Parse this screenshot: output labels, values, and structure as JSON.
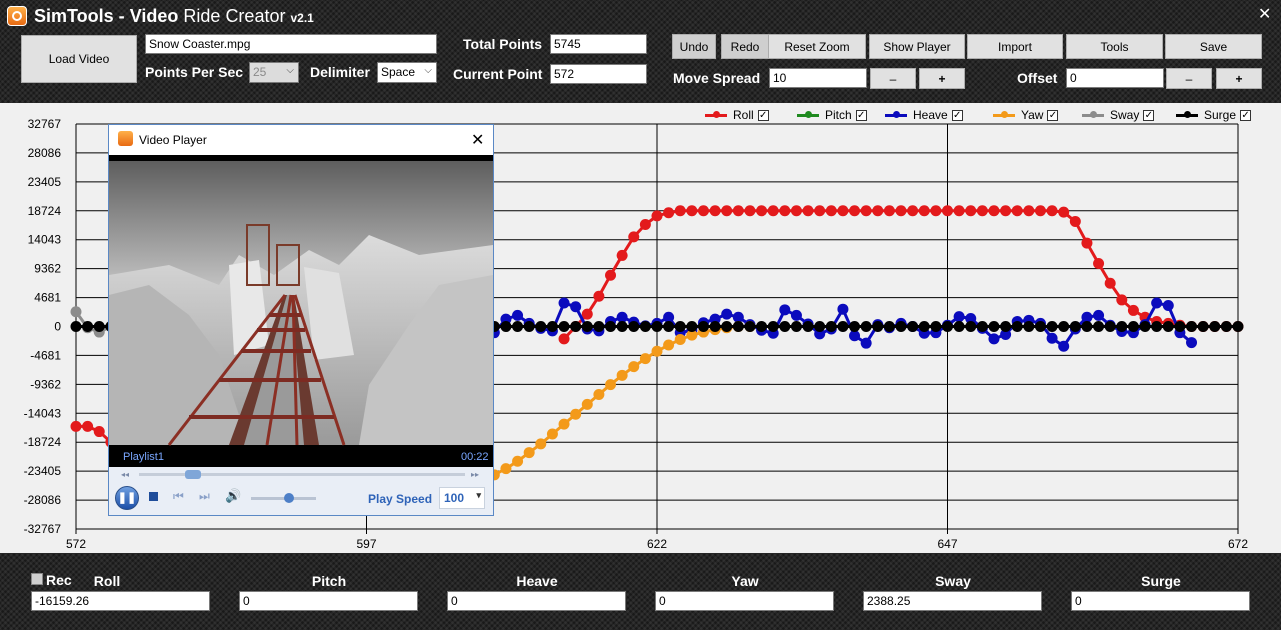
{
  "app": {
    "title_bold": "SimTools -",
    "title_mid_bold": "Video",
    "title_ride": "Ride",
    "title_creator": "Creator",
    "version": "v2.1"
  },
  "toolbar": {
    "load_video": "Load Video",
    "video_file": "Snow Coaster.mpg",
    "points_per_sec_label": "Points Per Sec",
    "points_per_sec_value": "25",
    "delimiter_label": "Delimiter",
    "delimiter_value": "Space",
    "total_points_label": "Total Points",
    "total_points_value": "5745",
    "current_point_label": "Current Point",
    "current_point_value": "572",
    "undo": "Undo",
    "redo": "Redo",
    "reset_zoom": "Reset Zoom",
    "show_player": "Show Player",
    "import": "Import",
    "tools": "Tools",
    "save": "Save",
    "move_spread_label": "Move Spread",
    "move_spread_value": "10",
    "minus": "–",
    "plus": "+",
    "offset_label": "Offset",
    "offset_value": "0"
  },
  "legend": [
    {
      "name": "Roll",
      "color": "#e31a1c",
      "checked": "✓"
    },
    {
      "name": "Pitch",
      "color": "#1f8a1f",
      "checked": "✓"
    },
    {
      "name": "Heave",
      "color": "#0b0bbd",
      "checked": "✓"
    },
    {
      "name": "Yaw",
      "color": "#f39a1a",
      "checked": "✓"
    },
    {
      "name": "Sway",
      "color": "#8c8c8c",
      "checked": "✓"
    },
    {
      "name": "Surge",
      "color": "#000000",
      "checked": "✓"
    }
  ],
  "chart_data": {
    "type": "line",
    "ylim": [
      -32767,
      32767
    ],
    "y_ticks": [
      "32767",
      "28086",
      "23405",
      "18724",
      "14043",
      "9362",
      "4681",
      "0",
      "-4681",
      "-9362",
      "-14043",
      "-18724",
      "-23405",
      "-28086",
      "-32767"
    ],
    "x_ticks": [
      "572",
      "597",
      "622",
      "647",
      "672"
    ],
    "xlim": [
      572,
      672
    ],
    "series": [
      {
        "name": "Roll",
        "color": "#e31a1c",
        "points": [
          [
            572,
            -16159
          ],
          [
            573,
            -16159
          ],
          [
            574,
            -17000
          ],
          [
            575,
            -18700
          ],
          [
            576,
            -20000
          ],
          [
            577,
            -21000
          ],
          [
            614,
            -2000
          ],
          [
            615,
            0
          ],
          [
            616,
            2000
          ],
          [
            617,
            4900
          ],
          [
            618,
            8300
          ],
          [
            619,
            11500
          ],
          [
            620,
            14500
          ],
          [
            621,
            16500
          ],
          [
            622,
            17900
          ],
          [
            623,
            18400
          ],
          [
            624,
            18724
          ],
          [
            625,
            18724
          ],
          [
            626,
            18724
          ],
          [
            627,
            18724
          ],
          [
            628,
            18724
          ],
          [
            629,
            18724
          ],
          [
            630,
            18724
          ],
          [
            631,
            18724
          ],
          [
            632,
            18724
          ],
          [
            633,
            18724
          ],
          [
            634,
            18724
          ],
          [
            635,
            18724
          ],
          [
            636,
            18724
          ],
          [
            637,
            18724
          ],
          [
            638,
            18724
          ],
          [
            639,
            18724
          ],
          [
            640,
            18724
          ],
          [
            641,
            18724
          ],
          [
            642,
            18724
          ],
          [
            643,
            18724
          ],
          [
            644,
            18724
          ],
          [
            645,
            18724
          ],
          [
            646,
            18724
          ],
          [
            647,
            18724
          ],
          [
            648,
            18724
          ],
          [
            649,
            18724
          ],
          [
            650,
            18724
          ],
          [
            651,
            18724
          ],
          [
            652,
            18724
          ],
          [
            653,
            18724
          ],
          [
            654,
            18724
          ],
          [
            655,
            18724
          ],
          [
            656,
            18724
          ],
          [
            657,
            18500
          ],
          [
            658,
            17000
          ],
          [
            659,
            13500
          ],
          [
            660,
            10200
          ],
          [
            661,
            7000
          ],
          [
            662,
            4300
          ],
          [
            663,
            2600
          ],
          [
            664,
            1500
          ],
          [
            665,
            800
          ],
          [
            666,
            500
          ],
          [
            667,
            200
          ],
          [
            668,
            0
          ],
          [
            669,
            0
          ],
          [
            670,
            0
          ],
          [
            671,
            0
          ],
          [
            672,
            0
          ]
        ]
      },
      {
        "name": "Heave",
        "color": "#0b0bbd",
        "points": [
          [
            605,
            0
          ],
          [
            606,
            -1500
          ],
          [
            607,
            -3000
          ],
          [
            608,
            -1000
          ],
          [
            609,
            1200
          ],
          [
            610,
            1800
          ],
          [
            611,
            500
          ],
          [
            612,
            -300
          ],
          [
            613,
            -700
          ],
          [
            614,
            3800
          ],
          [
            615,
            3200
          ],
          [
            616,
            -400
          ],
          [
            617,
            -700
          ],
          [
            618,
            800
          ],
          [
            619,
            1500
          ],
          [
            620,
            700
          ],
          [
            621,
            100
          ],
          [
            622,
            500
          ],
          [
            623,
            1500
          ],
          [
            624,
            -1000
          ],
          [
            625,
            -600
          ],
          [
            626,
            600
          ],
          [
            627,
            1200
          ],
          [
            628,
            2000
          ],
          [
            629,
            1500
          ],
          [
            630,
            300
          ],
          [
            631,
            -600
          ],
          [
            632,
            -1100
          ],
          [
            633,
            2700
          ],
          [
            634,
            1800
          ],
          [
            635,
            400
          ],
          [
            636,
            -1200
          ],
          [
            637,
            -400
          ],
          [
            638,
            2800
          ],
          [
            639,
            -1500
          ],
          [
            640,
            -2700
          ],
          [
            641,
            300
          ],
          [
            642,
            -200
          ],
          [
            643,
            500
          ],
          [
            644,
            0
          ],
          [
            645,
            -1100
          ],
          [
            646,
            -1000
          ],
          [
            647,
            200
          ],
          [
            648,
            1600
          ],
          [
            649,
            1300
          ],
          [
            650,
            -300
          ],
          [
            651,
            -2000
          ],
          [
            652,
            -1300
          ],
          [
            653,
            800
          ],
          [
            654,
            1000
          ],
          [
            655,
            500
          ],
          [
            656,
            -1900
          ],
          [
            657,
            -3200
          ],
          [
            658,
            -400
          ],
          [
            659,
            1500
          ],
          [
            660,
            1800
          ],
          [
            661,
            200
          ],
          [
            662,
            -800
          ],
          [
            663,
            -1000
          ],
          [
            664,
            300
          ],
          [
            665,
            3800
          ],
          [
            666,
            3400
          ],
          [
            667,
            -1000
          ],
          [
            668,
            -2600
          ]
        ]
      },
      {
        "name": "Yaw",
        "color": "#f39a1a",
        "points": [
          [
            605,
            -26500
          ],
          [
            606,
            -25800
          ],
          [
            607,
            -25000
          ],
          [
            608,
            -24000
          ],
          [
            609,
            -23000
          ],
          [
            610,
            -21800
          ],
          [
            611,
            -20400
          ],
          [
            612,
            -19000
          ],
          [
            613,
            -17400
          ],
          [
            614,
            -15800
          ],
          [
            615,
            -14200
          ],
          [
            616,
            -12600
          ],
          [
            617,
            -11000
          ],
          [
            618,
            -9400
          ],
          [
            619,
            -7900
          ],
          [
            620,
            -6500
          ],
          [
            621,
            -5200
          ],
          [
            622,
            -4000
          ],
          [
            623,
            -3000
          ],
          [
            624,
            -2100
          ],
          [
            625,
            -1400
          ],
          [
            626,
            -900
          ],
          [
            627,
            -500
          ],
          [
            628,
            -200
          ],
          [
            629,
            0
          ],
          [
            630,
            0
          ]
        ]
      },
      {
        "name": "Sway",
        "color": "#8c8c8c",
        "points": [
          [
            572,
            2388
          ],
          [
            573,
            -200
          ],
          [
            574,
            -900
          ],
          [
            575,
            0
          ]
        ]
      },
      {
        "name": "Surge",
        "color": "#000000",
        "points": [
          [
            572,
            0
          ],
          [
            573,
            0
          ],
          [
            574,
            0
          ],
          [
            575,
            0
          ],
          [
            576,
            0
          ],
          [
            605,
            0
          ],
          [
            606,
            0
          ],
          [
            607,
            0
          ],
          [
            608,
            0
          ],
          [
            609,
            0
          ],
          [
            610,
            0
          ],
          [
            611,
            0
          ],
          [
            612,
            0
          ],
          [
            613,
            0
          ],
          [
            614,
            0
          ],
          [
            615,
            0
          ],
          [
            616,
            0
          ],
          [
            617,
            0
          ],
          [
            618,
            0
          ],
          [
            619,
            0
          ],
          [
            620,
            0
          ],
          [
            621,
            0
          ],
          [
            622,
            0
          ],
          [
            623,
            0
          ],
          [
            624,
            0
          ],
          [
            625,
            0
          ],
          [
            626,
            0
          ],
          [
            627,
            0
          ],
          [
            628,
            0
          ],
          [
            629,
            0
          ],
          [
            630,
            0
          ],
          [
            631,
            0
          ],
          [
            632,
            0
          ],
          [
            633,
            0
          ],
          [
            634,
            0
          ],
          [
            635,
            0
          ],
          [
            636,
            0
          ],
          [
            637,
            0
          ],
          [
            638,
            0
          ],
          [
            639,
            0
          ],
          [
            640,
            0
          ],
          [
            641,
            0
          ],
          [
            642,
            0
          ],
          [
            643,
            0
          ],
          [
            644,
            0
          ],
          [
            645,
            0
          ],
          [
            646,
            0
          ],
          [
            647,
            0
          ],
          [
            648,
            0
          ],
          [
            649,
            0
          ],
          [
            650,
            0
          ],
          [
            651,
            0
          ],
          [
            652,
            0
          ],
          [
            653,
            0
          ],
          [
            654,
            0
          ],
          [
            655,
            0
          ],
          [
            656,
            0
          ],
          [
            657,
            0
          ],
          [
            658,
            0
          ],
          [
            659,
            0
          ],
          [
            660,
            0
          ],
          [
            661,
            0
          ],
          [
            662,
            0
          ],
          [
            663,
            0
          ],
          [
            664,
            0
          ],
          [
            665,
            0
          ],
          [
            666,
            0
          ],
          [
            667,
            0
          ],
          [
            668,
            0
          ],
          [
            669,
            0
          ],
          [
            670,
            0
          ],
          [
            671,
            0
          ],
          [
            672,
            0
          ]
        ]
      }
    ]
  },
  "player": {
    "title": "Video Player",
    "playlist": "Playlist1",
    "time": "00:22",
    "play_speed_label": "Play Speed",
    "play_speed_value": "100",
    "seek_position": 0.14,
    "volume_level": 0.5
  },
  "bottom": {
    "rec_label": "Rec",
    "fields": [
      {
        "label": "Roll",
        "value": "-16159.26"
      },
      {
        "label": "Pitch",
        "value": "0"
      },
      {
        "label": "Heave",
        "value": "0"
      },
      {
        "label": "Yaw",
        "value": "0"
      },
      {
        "label": "Sway",
        "value": "2388.25"
      },
      {
        "label": "Surge",
        "value": "0"
      }
    ]
  }
}
